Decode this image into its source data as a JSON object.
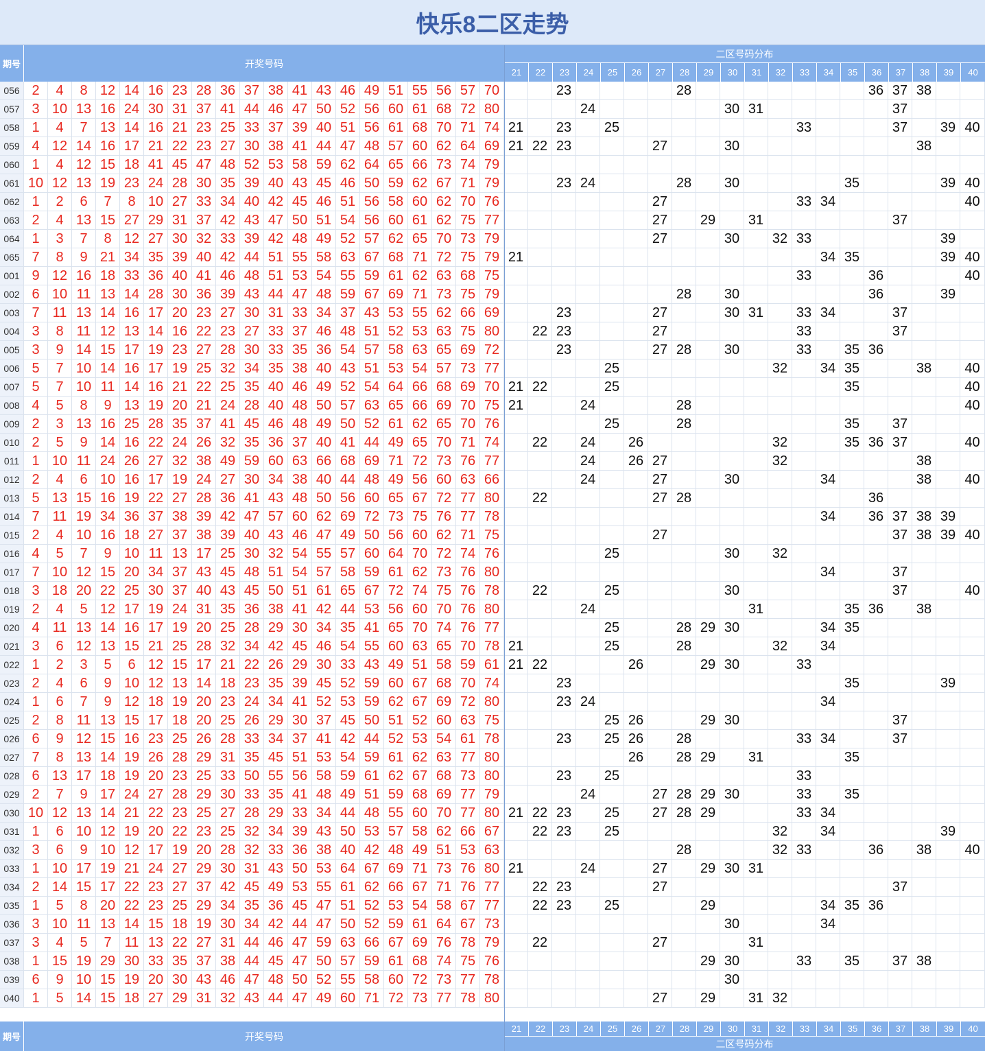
{
  "title": "快乐8二区走势",
  "header": {
    "period_label": "期号",
    "draw_label": "开奖号码",
    "dist_label": "二区号码分布",
    "zone_numbers": [
      "21",
      "22",
      "23",
      "24",
      "25",
      "26",
      "27",
      "28",
      "29",
      "30",
      "31",
      "32",
      "33",
      "34",
      "35",
      "36",
      "37",
      "38",
      "39",
      "40"
    ]
  },
  "colors": {
    "header_bg": "#84b0ea",
    "title_bg": "#dde9f9",
    "title_text": "#3b5ea8",
    "winning_number": "#e8281f",
    "zone_number": "#111111"
  },
  "rows": [
    {
      "period": "056",
      "numbers": [
        "2",
        "4",
        "8",
        "12",
        "14",
        "16",
        "23",
        "28",
        "36",
        "37",
        "38",
        "41",
        "43",
        "46",
        "49",
        "51",
        "55",
        "56",
        "57",
        "70"
      ]
    },
    {
      "period": "057",
      "numbers": [
        "3",
        "10",
        "13",
        "16",
        "24",
        "30",
        "31",
        "37",
        "41",
        "44",
        "46",
        "47",
        "50",
        "52",
        "56",
        "60",
        "61",
        "68",
        "72",
        "80"
      ]
    },
    {
      "period": "058",
      "numbers": [
        "1",
        "4",
        "7",
        "13",
        "14",
        "16",
        "21",
        "23",
        "25",
        "33",
        "37",
        "39",
        "40",
        "51",
        "56",
        "61",
        "68",
        "70",
        "71",
        "74"
      ]
    },
    {
      "period": "059",
      "numbers": [
        "4",
        "12",
        "14",
        "16",
        "17",
        "21",
        "22",
        "23",
        "27",
        "30",
        "38",
        "41",
        "44",
        "47",
        "48",
        "57",
        "60",
        "62",
        "64",
        "69"
      ]
    },
    {
      "period": "060",
      "numbers": [
        "1",
        "4",
        "12",
        "15",
        "18",
        "41",
        "45",
        "47",
        "48",
        "52",
        "53",
        "58",
        "59",
        "62",
        "64",
        "65",
        "66",
        "73",
        "74",
        "79"
      ]
    },
    {
      "period": "061",
      "numbers": [
        "10",
        "12",
        "13",
        "19",
        "23",
        "24",
        "28",
        "30",
        "35",
        "39",
        "40",
        "43",
        "45",
        "46",
        "50",
        "59",
        "62",
        "67",
        "71",
        "79"
      ]
    },
    {
      "period": "062",
      "numbers": [
        "1",
        "2",
        "6",
        "7",
        "8",
        "10",
        "27",
        "33",
        "34",
        "40",
        "42",
        "45",
        "46",
        "51",
        "56",
        "58",
        "60",
        "62",
        "70",
        "76"
      ]
    },
    {
      "period": "063",
      "numbers": [
        "2",
        "4",
        "13",
        "15",
        "27",
        "29",
        "31",
        "37",
        "42",
        "43",
        "47",
        "50",
        "51",
        "54",
        "56",
        "60",
        "61",
        "62",
        "75",
        "77"
      ]
    },
    {
      "period": "064",
      "numbers": [
        "1",
        "3",
        "7",
        "8",
        "12",
        "27",
        "30",
        "32",
        "33",
        "39",
        "42",
        "48",
        "49",
        "52",
        "57",
        "62",
        "65",
        "70",
        "73",
        "79"
      ]
    },
    {
      "period": "065",
      "numbers": [
        "7",
        "8",
        "9",
        "21",
        "34",
        "35",
        "39",
        "40",
        "42",
        "44",
        "51",
        "55",
        "58",
        "63",
        "67",
        "68",
        "71",
        "72",
        "75",
        "79"
      ]
    },
    {
      "period": "001",
      "numbers": [
        "9",
        "12",
        "16",
        "18",
        "33",
        "36",
        "40",
        "41",
        "46",
        "48",
        "51",
        "53",
        "54",
        "55",
        "59",
        "61",
        "62",
        "63",
        "68",
        "75"
      ]
    },
    {
      "period": "002",
      "numbers": [
        "6",
        "10",
        "11",
        "13",
        "14",
        "28",
        "30",
        "36",
        "39",
        "43",
        "44",
        "47",
        "48",
        "59",
        "67",
        "69",
        "71",
        "73",
        "75",
        "79"
      ]
    },
    {
      "period": "003",
      "numbers": [
        "7",
        "11",
        "13",
        "14",
        "16",
        "17",
        "20",
        "23",
        "27",
        "30",
        "31",
        "33",
        "34",
        "37",
        "43",
        "53",
        "55",
        "62",
        "66",
        "69"
      ]
    },
    {
      "period": "004",
      "numbers": [
        "3",
        "8",
        "11",
        "12",
        "13",
        "14",
        "16",
        "22",
        "23",
        "27",
        "33",
        "37",
        "46",
        "48",
        "51",
        "52",
        "53",
        "63",
        "75",
        "80"
      ]
    },
    {
      "period": "005",
      "numbers": [
        "3",
        "9",
        "14",
        "15",
        "17",
        "19",
        "23",
        "27",
        "28",
        "30",
        "33",
        "35",
        "36",
        "54",
        "57",
        "58",
        "63",
        "65",
        "69",
        "72"
      ]
    },
    {
      "period": "006",
      "numbers": [
        "5",
        "7",
        "10",
        "14",
        "16",
        "17",
        "19",
        "25",
        "32",
        "34",
        "35",
        "38",
        "40",
        "43",
        "51",
        "53",
        "54",
        "57",
        "73",
        "77"
      ]
    },
    {
      "period": "007",
      "numbers": [
        "5",
        "7",
        "10",
        "11",
        "14",
        "16",
        "21",
        "22",
        "25",
        "35",
        "40",
        "46",
        "49",
        "52",
        "54",
        "64",
        "66",
        "68",
        "69",
        "70"
      ]
    },
    {
      "period": "008",
      "numbers": [
        "4",
        "5",
        "8",
        "9",
        "13",
        "19",
        "20",
        "21",
        "24",
        "28",
        "40",
        "48",
        "50",
        "57",
        "63",
        "65",
        "66",
        "69",
        "70",
        "75"
      ]
    },
    {
      "period": "009",
      "numbers": [
        "2",
        "3",
        "13",
        "16",
        "25",
        "28",
        "35",
        "37",
        "41",
        "45",
        "46",
        "48",
        "49",
        "50",
        "52",
        "61",
        "62",
        "65",
        "70",
        "76"
      ]
    },
    {
      "period": "010",
      "numbers": [
        "2",
        "5",
        "9",
        "14",
        "16",
        "22",
        "24",
        "26",
        "32",
        "35",
        "36",
        "37",
        "40",
        "41",
        "44",
        "49",
        "65",
        "70",
        "71",
        "74"
      ]
    },
    {
      "period": "011",
      "numbers": [
        "1",
        "10",
        "11",
        "24",
        "26",
        "27",
        "32",
        "38",
        "49",
        "59",
        "60",
        "63",
        "66",
        "68",
        "69",
        "71",
        "72",
        "73",
        "76",
        "77"
      ]
    },
    {
      "period": "012",
      "numbers": [
        "2",
        "4",
        "6",
        "10",
        "16",
        "17",
        "19",
        "24",
        "27",
        "30",
        "34",
        "38",
        "40",
        "44",
        "48",
        "49",
        "56",
        "60",
        "63",
        "66"
      ]
    },
    {
      "period": "013",
      "numbers": [
        "5",
        "13",
        "15",
        "16",
        "19",
        "22",
        "27",
        "28",
        "36",
        "41",
        "43",
        "48",
        "50",
        "56",
        "60",
        "65",
        "67",
        "72",
        "77",
        "80"
      ]
    },
    {
      "period": "014",
      "numbers": [
        "7",
        "11",
        "19",
        "34",
        "36",
        "37",
        "38",
        "39",
        "42",
        "47",
        "57",
        "60",
        "62",
        "69",
        "72",
        "73",
        "75",
        "76",
        "77",
        "78"
      ]
    },
    {
      "period": "015",
      "numbers": [
        "2",
        "4",
        "10",
        "16",
        "18",
        "27",
        "37",
        "38",
        "39",
        "40",
        "43",
        "46",
        "47",
        "49",
        "50",
        "56",
        "60",
        "62",
        "71",
        "75"
      ]
    },
    {
      "period": "016",
      "numbers": [
        "4",
        "5",
        "7",
        "9",
        "10",
        "11",
        "13",
        "17",
        "25",
        "30",
        "32",
        "54",
        "55",
        "57",
        "60",
        "64",
        "70",
        "72",
        "74",
        "76"
      ]
    },
    {
      "period": "017",
      "numbers": [
        "7",
        "10",
        "12",
        "15",
        "20",
        "34",
        "37",
        "43",
        "45",
        "48",
        "51",
        "54",
        "57",
        "58",
        "59",
        "61",
        "62",
        "73",
        "76",
        "80"
      ]
    },
    {
      "period": "018",
      "numbers": [
        "3",
        "18",
        "20",
        "22",
        "25",
        "30",
        "37",
        "40",
        "43",
        "45",
        "50",
        "51",
        "61",
        "65",
        "67",
        "72",
        "74",
        "75",
        "76",
        "78"
      ]
    },
    {
      "period": "019",
      "numbers": [
        "2",
        "4",
        "5",
        "12",
        "17",
        "19",
        "24",
        "31",
        "35",
        "36",
        "38",
        "41",
        "42",
        "44",
        "53",
        "56",
        "60",
        "70",
        "76",
        "80"
      ]
    },
    {
      "period": "020",
      "numbers": [
        "4",
        "11",
        "13",
        "14",
        "16",
        "17",
        "19",
        "20",
        "25",
        "28",
        "29",
        "30",
        "34",
        "35",
        "41",
        "65",
        "70",
        "74",
        "76",
        "77"
      ]
    },
    {
      "period": "021",
      "numbers": [
        "3",
        "6",
        "12",
        "13",
        "15",
        "21",
        "25",
        "28",
        "32",
        "34",
        "42",
        "45",
        "46",
        "54",
        "55",
        "60",
        "63",
        "65",
        "70",
        "78"
      ]
    },
    {
      "period": "022",
      "numbers": [
        "1",
        "2",
        "3",
        "5",
        "6",
        "12",
        "15",
        "17",
        "21",
        "22",
        "26",
        "29",
        "30",
        "33",
        "43",
        "49",
        "51",
        "58",
        "59",
        "61"
      ]
    },
    {
      "period": "023",
      "numbers": [
        "2",
        "4",
        "6",
        "9",
        "10",
        "12",
        "13",
        "14",
        "18",
        "23",
        "35",
        "39",
        "45",
        "52",
        "59",
        "60",
        "67",
        "68",
        "70",
        "74"
      ]
    },
    {
      "period": "024",
      "numbers": [
        "1",
        "6",
        "7",
        "9",
        "12",
        "18",
        "19",
        "20",
        "23",
        "24",
        "34",
        "41",
        "52",
        "53",
        "59",
        "62",
        "67",
        "69",
        "72",
        "80"
      ]
    },
    {
      "period": "025",
      "numbers": [
        "2",
        "8",
        "11",
        "13",
        "15",
        "17",
        "18",
        "20",
        "25",
        "26",
        "29",
        "30",
        "37",
        "45",
        "50",
        "51",
        "52",
        "60",
        "63",
        "75"
      ]
    },
    {
      "period": "026",
      "numbers": [
        "6",
        "9",
        "12",
        "15",
        "16",
        "23",
        "25",
        "26",
        "28",
        "33",
        "34",
        "37",
        "41",
        "42",
        "44",
        "52",
        "53",
        "54",
        "61",
        "78"
      ]
    },
    {
      "period": "027",
      "numbers": [
        "7",
        "8",
        "13",
        "14",
        "19",
        "26",
        "28",
        "29",
        "31",
        "35",
        "45",
        "51",
        "53",
        "54",
        "59",
        "61",
        "62",
        "63",
        "77",
        "80"
      ]
    },
    {
      "period": "028",
      "numbers": [
        "6",
        "13",
        "17",
        "18",
        "19",
        "20",
        "23",
        "25",
        "33",
        "50",
        "55",
        "56",
        "58",
        "59",
        "61",
        "62",
        "67",
        "68",
        "73",
        "80"
      ]
    },
    {
      "period": "029",
      "numbers": [
        "2",
        "7",
        "9",
        "17",
        "24",
        "27",
        "28",
        "29",
        "30",
        "33",
        "35",
        "41",
        "48",
        "49",
        "51",
        "59",
        "68",
        "69",
        "77",
        "79"
      ]
    },
    {
      "period": "030",
      "numbers": [
        "10",
        "12",
        "13",
        "14",
        "21",
        "22",
        "23",
        "25",
        "27",
        "28",
        "29",
        "33",
        "34",
        "44",
        "48",
        "55",
        "60",
        "70",
        "77",
        "80"
      ]
    },
    {
      "period": "031",
      "numbers": [
        "1",
        "6",
        "10",
        "12",
        "19",
        "20",
        "22",
        "23",
        "25",
        "32",
        "34",
        "39",
        "43",
        "50",
        "53",
        "57",
        "58",
        "62",
        "66",
        "67"
      ]
    },
    {
      "period": "032",
      "numbers": [
        "3",
        "6",
        "9",
        "10",
        "12",
        "17",
        "19",
        "20",
        "28",
        "32",
        "33",
        "36",
        "38",
        "40",
        "42",
        "48",
        "49",
        "51",
        "53",
        "63"
      ]
    },
    {
      "period": "033",
      "numbers": [
        "1",
        "10",
        "17",
        "19",
        "21",
        "24",
        "27",
        "29",
        "30",
        "31",
        "43",
        "50",
        "53",
        "64",
        "67",
        "69",
        "71",
        "73",
        "76",
        "80"
      ]
    },
    {
      "period": "034",
      "numbers": [
        "2",
        "14",
        "15",
        "17",
        "22",
        "23",
        "27",
        "37",
        "42",
        "45",
        "49",
        "53",
        "55",
        "61",
        "62",
        "66",
        "67",
        "71",
        "76",
        "77"
      ]
    },
    {
      "period": "035",
      "numbers": [
        "1",
        "5",
        "8",
        "20",
        "22",
        "23",
        "25",
        "29",
        "34",
        "35",
        "36",
        "45",
        "47",
        "51",
        "52",
        "53",
        "54",
        "58",
        "67",
        "77"
      ]
    },
    {
      "period": "036",
      "numbers": [
        "3",
        "10",
        "11",
        "13",
        "14",
        "15",
        "18",
        "19",
        "30",
        "34",
        "42",
        "44",
        "47",
        "50",
        "52",
        "59",
        "61",
        "64",
        "67",
        "73"
      ]
    },
    {
      "period": "037",
      "numbers": [
        "3",
        "4",
        "5",
        "7",
        "11",
        "13",
        "22",
        "27",
        "31",
        "44",
        "46",
        "47",
        "59",
        "63",
        "66",
        "67",
        "69",
        "76",
        "78",
        "79"
      ]
    },
    {
      "period": "038",
      "numbers": [
        "1",
        "15",
        "19",
        "29",
        "30",
        "33",
        "35",
        "37",
        "38",
        "44",
        "45",
        "47",
        "50",
        "57",
        "59",
        "61",
        "68",
        "74",
        "75",
        "76"
      ]
    },
    {
      "period": "039",
      "numbers": [
        "6",
        "9",
        "10",
        "15",
        "19",
        "20",
        "30",
        "43",
        "46",
        "47",
        "48",
        "50",
        "52",
        "55",
        "58",
        "60",
        "72",
        "73",
        "77",
        "78"
      ]
    },
    {
      "period": "040",
      "numbers": [
        "1",
        "5",
        "14",
        "15",
        "18",
        "27",
        "29",
        "31",
        "32",
        "43",
        "44",
        "47",
        "49",
        "60",
        "71",
        "72",
        "73",
        "77",
        "78",
        "80"
      ]
    }
  ]
}
